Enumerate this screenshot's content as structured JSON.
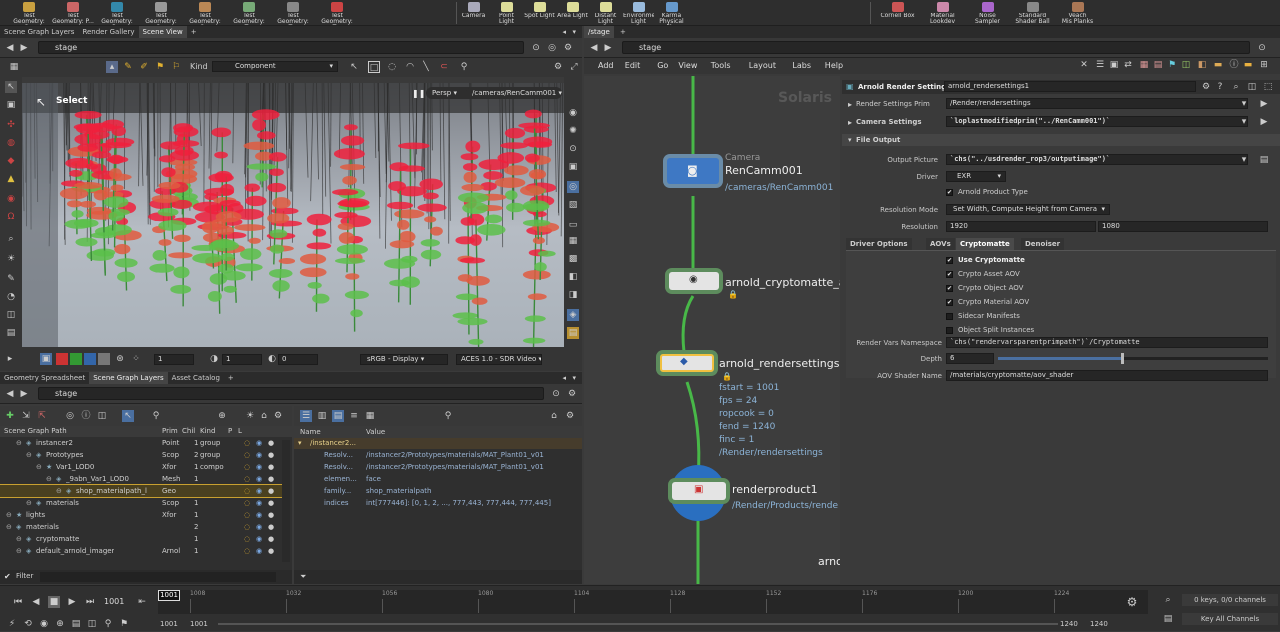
{
  "shelf": {
    "left_tools": [
      {
        "label": "Test\nGeometry: C...",
        "icon": "#c9a040"
      },
      {
        "label": "Test\nGeometry: P...",
        "icon": "#c66"
      },
      {
        "label": "Test\nGeometry: R...",
        "icon": "#38a"
      },
      {
        "label": "Test\nGeometry: S...",
        "icon": "#999"
      },
      {
        "label": "Test\nGeometry: S...",
        "icon": "#b85"
      },
      {
        "label": "Test\nGeometry: T...",
        "icon": "#7a7"
      },
      {
        "label": "Test\nGeometry: T...",
        "icon": "#888"
      },
      {
        "label": "Test\nGeometry: T...",
        "icon": "#c44"
      }
    ],
    "mid_tools": [
      {
        "label": "Camera",
        "icon": "#aab"
      },
      {
        "label": "Point Light",
        "icon": "#dd9"
      },
      {
        "label": "Spot Light",
        "icon": "#dd9"
      },
      {
        "label": "Area Light",
        "icon": "#dd9"
      },
      {
        "label": "Distant Light",
        "icon": "#dd9"
      },
      {
        "label": "Environment\nLight",
        "icon": "#9bd"
      },
      {
        "label": "Karma\nPhysical Sky",
        "icon": "#69c"
      }
    ],
    "right_tools": [
      {
        "label": "Cornell Box",
        "icon": "#c55"
      },
      {
        "label": "Material\nLookdev",
        "icon": "#c8a"
      },
      {
        "label": "Noise Sampler",
        "icon": "#a6c"
      },
      {
        "label": "Standard\nShader Ball",
        "icon": "#888"
      },
      {
        "label": "Veach\nMis Planks",
        "icon": "#a75"
      }
    ]
  },
  "left_top": {
    "tabs": [
      "Scene Graph Layers",
      "Render Gallery",
      "Scene View"
    ],
    "active_tab": 2,
    "path": "stage",
    "kind_label": "Kind",
    "kind_value": "Component",
    "select_label": "Select",
    "persp": "Persp",
    "camera": "/cameras/RenCamm001",
    "frame_a": "1",
    "frame_b": "1",
    "frame_c": "0",
    "display": "sRGB - Display",
    "view_transform": "ACES 1.0 - SDR Video"
  },
  "left_bottom": {
    "tabs": [
      "Geometry Spreadsheet",
      "Scene Graph Layers",
      "Asset Catalog"
    ],
    "active_tab": 1,
    "path": "stage",
    "headers": [
      "Scene Graph Path",
      "Prim",
      "Chil",
      "Kind",
      "P",
      "L"
    ],
    "rows": [
      {
        "indent": 2,
        "name": "instancer2",
        "prim": "Point",
        "chil": "1",
        "kind": "group"
      },
      {
        "indent": 3,
        "name": "Prototypes",
        "prim": "Scop",
        "chil": "2",
        "kind": "group"
      },
      {
        "indent": 4,
        "name": "Var1_LOD0",
        "prim": "Xfor",
        "chil": "1",
        "kind": "compo"
      },
      {
        "indent": 5,
        "name": "_9abn_Var1_LOD0",
        "prim": "Mesh",
        "chil": "1",
        "kind": ""
      },
      {
        "indent": 6,
        "name": "shop_materialpath_l",
        "prim": "Geo",
        "chil": "",
        "kind": ""
      },
      {
        "indent": 3,
        "name": "materials",
        "prim": "Scop",
        "chil": "1",
        "kind": ""
      },
      {
        "indent": 1,
        "name": "lights",
        "prim": "Xfor",
        "chil": "1",
        "kind": ""
      },
      {
        "indent": 1,
        "name": "materials",
        "prim": "",
        "chil": "2",
        "kind": ""
      },
      {
        "indent": 2,
        "name": "cryptomatte",
        "prim": "",
        "chil": "1",
        "kind": ""
      },
      {
        "indent": 2,
        "name": "default_arnold_imager",
        "prim": "Arnol",
        "chil": "1",
        "kind": ""
      }
    ],
    "filter_label": "Filter",
    "props_headers": [
      "Name",
      "Value"
    ],
    "props_group": "/instancer2...",
    "props": [
      {
        "name": "Resolv...",
        "value": "/instancer2/Prototypes/materials/MAT_Plant01_v01"
      },
      {
        "name": "Resolv...",
        "value": "/instancer2/Prototypes/materials/MAT_Plant01_v01"
      },
      {
        "name": "elemen...",
        "value": "face"
      },
      {
        "name": "family...",
        "value": "shop_materialpath"
      },
      {
        "name": "indices",
        "value": "int[777446]: [0, 1, 2, ..., 777,443, 777,444, 777,445]"
      }
    ]
  },
  "right": {
    "tab": "/stage",
    "path": "stage",
    "menu": [
      "Add",
      "Edit",
      "Go",
      "View",
      "Tools",
      "Layout",
      "Labs",
      "Help"
    ],
    "watermark": "Solaris",
    "nodes": {
      "camera_type": "Camera",
      "camera_name": "RenCamm001",
      "camera_path": "/cameras/RenCamm001",
      "crypto_name": "arnold_cryptomatte_ao",
      "rs_name": "arnold_rendersettings1",
      "rs_info": [
        "fstart = 1001",
        "fps = 24",
        "ropcook = 0",
        "fend = 1240",
        "finc = 1",
        "/Render/rendersettings"
      ],
      "rp_name": "renderproduct1",
      "rp_path": "/Render/Products/rende",
      "arnol": "arnol"
    },
    "params": {
      "node_type": "Arnold Render Settings",
      "node_name": "arnold_rendersettings1",
      "render_settings_prim_label": "Render Settings Prim",
      "render_settings_prim": "/Render/rendersettings",
      "camera_settings_label": "Camera Settings",
      "camera_settings": "`loplastmodifiedprim(\"../RenCamm001\")`",
      "file_output_label": "File Output",
      "output_picture_label": "Output Picture",
      "output_picture": "`chs(\"../usdrender_rop3/outputimage\")`",
      "driver_label": "Driver",
      "driver": "EXR",
      "arnold_product_type": "Arnold Product Type",
      "resolution_mode_label": "Resolution Mode",
      "resolution_mode": "Set Width, Compute Height from Camera",
      "resolution_label": "Resolution",
      "res_w": "1920",
      "res_h": "1080",
      "subtabs": [
        "Driver Options",
        "AOVs",
        "Cryptomatte",
        "Denoiser"
      ],
      "active_subtab": 2,
      "checks": [
        {
          "label": "Use Cryptomatte",
          "on": true,
          "bold": true
        },
        {
          "label": "Crypto Asset AOV",
          "on": true
        },
        {
          "label": "Crypto Object AOV",
          "on": true
        },
        {
          "label": "Crypto Material AOV",
          "on": true
        },
        {
          "label": "Sidecar Manifests",
          "on": false
        },
        {
          "label": "Object Split Instances",
          "on": false
        }
      ],
      "namespace_label": "Render Vars Namespace",
      "namespace": "`chs(\"rendervarsparentprimpath\")`/Cryptomatte",
      "depth_label": "Depth",
      "depth": "6",
      "depth_fraction": 0.46,
      "aov_shader_label": "AOV Shader Name",
      "aov_shader": "/materials/cryptomatte/aov_shader"
    }
  },
  "timeline": {
    "current": "1001",
    "marker": "1001",
    "ticks": [
      "1008",
      "1032",
      "1056",
      "1080",
      "1104",
      "1128",
      "1152",
      "1176",
      "1200",
      "1224"
    ],
    "start": "1001",
    "start2": "1001",
    "end": "1240",
    "end2": "1240",
    "keys": "0 keys, 0/0 channels",
    "key_all": "Key All Channels"
  },
  "colors": {
    "accent": "#f0c040",
    "node_green": "#5d8c5d",
    "wire": "#4fb84f",
    "select_blue": "#2a6fc0"
  }
}
